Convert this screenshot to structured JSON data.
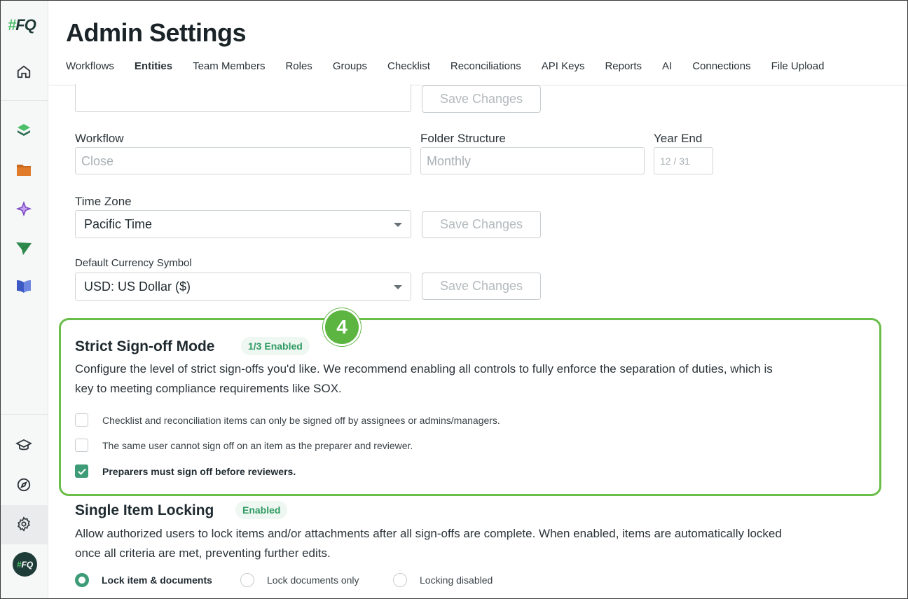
{
  "app": {
    "logo_text": "#FQ",
    "avatar_text": "#FQ"
  },
  "header": {
    "title": "Admin Settings",
    "tabs": [
      {
        "label": "Workflows"
      },
      {
        "label": "Entities",
        "active": true
      },
      {
        "label": "Team Members"
      },
      {
        "label": "Roles"
      },
      {
        "label": "Groups"
      },
      {
        "label": "Checklist"
      },
      {
        "label": "Reconciliations"
      },
      {
        "label": "API Keys"
      },
      {
        "label": "Reports"
      },
      {
        "label": "AI"
      },
      {
        "label": "Connections"
      },
      {
        "label": "File Upload"
      }
    ]
  },
  "sidebar": {
    "icons": [
      "home-icon",
      "layers-icon",
      "folder-icon",
      "sparkle-icon",
      "send-icon",
      "book-icon",
      "graduation-cap-icon",
      "compass-icon",
      "gear-icon"
    ]
  },
  "form": {
    "save_label": "Save Changes",
    "workflow": {
      "label": "Workflow",
      "placeholder": "Close"
    },
    "folder_structure": {
      "label": "Folder Structure",
      "placeholder": "Monthly"
    },
    "year_end": {
      "label": "Year End",
      "placeholder": "12 / 31"
    },
    "time_zone": {
      "label": "Time Zone",
      "value": "Pacific Time"
    },
    "currency": {
      "label": "Default Currency Symbol",
      "value": "USD: US Dollar ($)"
    }
  },
  "annotation": {
    "step_number": "4",
    "color": "#5bb540"
  },
  "strict_signoff": {
    "title": "Strict Sign-off Mode",
    "status": "1/3 Enabled",
    "description_line1": "Configure the level of strict sign-offs you'd like. We recommend enabling all controls to fully enforce the separation of duties, which is",
    "description_line2": "key to meeting compliance requirements like SOX.",
    "options": [
      {
        "label": "Checklist and reconciliation items can only be signed off by assignees or admins/managers.",
        "checked": false
      },
      {
        "label": "The same user cannot sign off on an item as the preparer and reviewer.",
        "checked": false
      },
      {
        "label": "Preparers must sign off before reviewers.",
        "checked": true
      }
    ]
  },
  "item_locking": {
    "title": "Single Item Locking",
    "status": "Enabled",
    "description_line1": "Allow authorized users to lock items and/or attachments after all sign-offs are complete. When enabled, items are automatically locked",
    "description_line2": "once all criteria are met, preventing further edits.",
    "options": [
      {
        "label": "Lock item & documents",
        "selected": true
      },
      {
        "label": "Lock documents only",
        "selected": false
      },
      {
        "label": "Locking disabled",
        "selected": false
      }
    ]
  },
  "colors": {
    "accent": "#3d9b76",
    "brand_dark": "#1f3d38",
    "highlight": "#6bbd4a"
  }
}
